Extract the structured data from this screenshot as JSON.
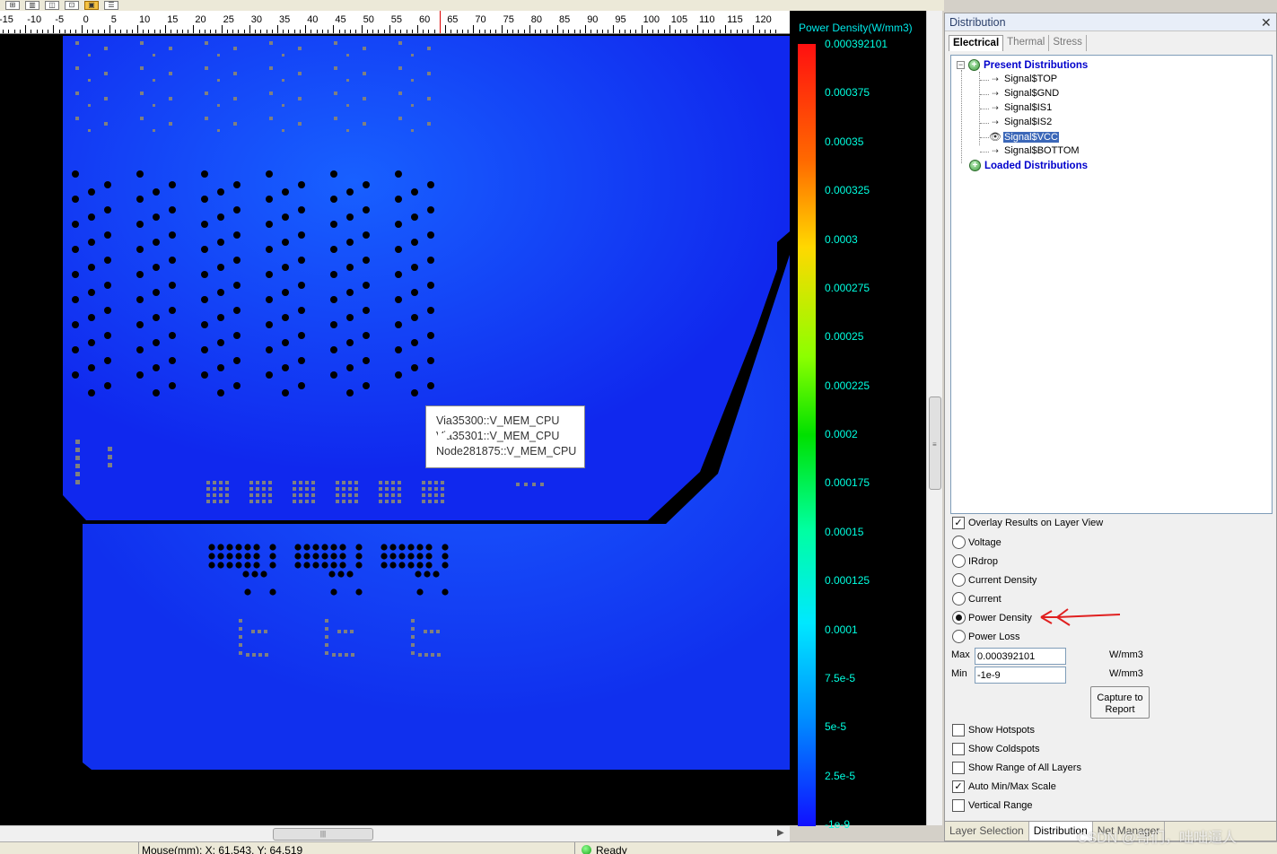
{
  "toolbar": {
    "icons": [
      "chart-icon",
      "chart-icon",
      "chart-icon",
      "chart-icon",
      "settings-icon",
      "report-icon"
    ]
  },
  "ruler": {
    "ticks": [
      "-15",
      "-10",
      "-5",
      "0",
      "5",
      "10",
      "15",
      "20",
      "25",
      "30",
      "35",
      "40",
      "45",
      "50",
      "55",
      "60",
      "65",
      "70",
      "75",
      "80",
      "85",
      "90",
      "95",
      "100",
      "105",
      "110",
      "115",
      "120"
    ]
  },
  "tooltip": {
    "lines": [
      "Via35300::V_MEM_CPU",
      "Via35301::V_MEM_CPU",
      "Node281875::V_MEM_CPU"
    ]
  },
  "legend": {
    "title": "Power Density(W/mm3)",
    "labels": [
      "0.000392101",
      "0.000375",
      "0.00035",
      "0.000325",
      "0.0003",
      "0.000275",
      "0.00025",
      "0.000225",
      "0.0002",
      "0.000175",
      "0.00015",
      "0.000125",
      "0.0001",
      "7.5e-5",
      "5e-5",
      "2.5e-5",
      "-1e-9"
    ],
    "colors": {
      "max": "#ff1010",
      "mid": "#00e000",
      "min": "#1010ff"
    }
  },
  "status": {
    "mouse": "Mouse(mm): X: 61.543, Y: 64.519",
    "ready": "Ready"
  },
  "panel": {
    "title": "Distribution",
    "tabs": [
      "Electrical",
      "Thermal",
      "Stress"
    ],
    "tree": {
      "present": "Present Distributions",
      "leaves": [
        "Signal$TOP",
        "Signal$GND",
        "Signal$IS1",
        "Signal$IS2",
        "Signal$VCC",
        "Signal$BOTTOM"
      ],
      "selected": "Signal$VCC",
      "loaded": "Loaded Distributions"
    },
    "overlay_label": "Overlay Results on Layer View",
    "overlay_checked": true,
    "radios": [
      "Voltage",
      "IRdrop",
      "Current Density",
      "Current",
      "Power Density",
      "Power Loss"
    ],
    "selected_radio": "Power Density",
    "max_label": "Max",
    "max_value": "0.000392101",
    "min_label": "Min",
    "min_value": "-1e-9",
    "unit": "W/mm3",
    "capture_line1": "Capture to",
    "capture_line2": "Report",
    "checkboxes": [
      {
        "label": "Show Hotspots",
        "checked": false
      },
      {
        "label": "Show Coldspots",
        "checked": false
      },
      {
        "label": "Show Range of All Layers",
        "checked": false
      },
      {
        "label": "Auto Min/Max Scale",
        "checked": true
      },
      {
        "label": "Vertical Range",
        "checked": false
      }
    ],
    "bottom_tabs": [
      "Layer Selection",
      "Distribution",
      "Net Manager"
    ],
    "active_bottom_tab": "Distribution"
  },
  "watermark": "CSDN @哥们，咄咄逼人"
}
